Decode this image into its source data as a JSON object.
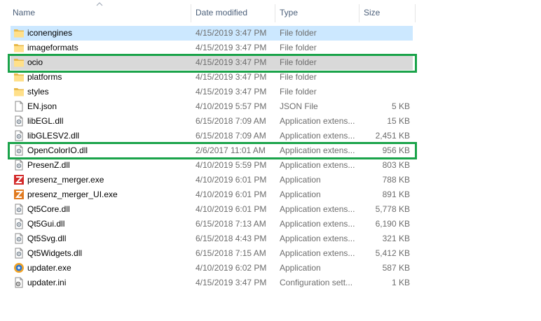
{
  "columns": {
    "name": "Name",
    "date_modified": "Date modified",
    "type": "Type",
    "size": "Size"
  },
  "sort": {
    "column": "name",
    "direction": "ascending",
    "icon": "sort-up-chevron"
  },
  "accent_color": "#1aa34a",
  "files": [
    {
      "name": "iconengines",
      "date": "4/15/2019 3:47 PM",
      "type": "File folder",
      "size": "",
      "icon": "folder-icon",
      "state": "selected"
    },
    {
      "name": "imageformats",
      "date": "4/15/2019 3:47 PM",
      "type": "File folder",
      "size": "",
      "icon": "folder-icon",
      "state": ""
    },
    {
      "name": "ocio",
      "date": "4/15/2019 3:47 PM",
      "type": "File folder",
      "size": "",
      "icon": "folder-icon",
      "state": "hover"
    },
    {
      "name": "platforms",
      "date": "4/15/2019 3:47 PM",
      "type": "File folder",
      "size": "",
      "icon": "folder-icon",
      "state": ""
    },
    {
      "name": "styles",
      "date": "4/15/2019 3:47 PM",
      "type": "File folder",
      "size": "",
      "icon": "folder-icon",
      "state": ""
    },
    {
      "name": "EN.json",
      "date": "4/10/2019 5:57 PM",
      "type": "JSON File",
      "size": "5 KB",
      "icon": "document-icon",
      "state": ""
    },
    {
      "name": "libEGL.dll",
      "date": "6/15/2018 7:09 AM",
      "type": "Application extens...",
      "size": "15 KB",
      "icon": "dll-gear-icon",
      "state": ""
    },
    {
      "name": "libGLESV2.dll",
      "date": "6/15/2018 7:09 AM",
      "type": "Application extens...",
      "size": "2,451 KB",
      "icon": "dll-gear-icon",
      "state": ""
    },
    {
      "name": "OpenColorIO.dll",
      "date": "2/6/2017 11:01 AM",
      "type": "Application extens...",
      "size": "956 KB",
      "icon": "dll-gear-icon",
      "state": ""
    },
    {
      "name": "PresenZ.dll",
      "date": "4/10/2019 5:59 PM",
      "type": "Application extens...",
      "size": "803 KB",
      "icon": "dll-gear-icon",
      "state": ""
    },
    {
      "name": "presenz_merger.exe",
      "date": "4/10/2019 6:01 PM",
      "type": "Application",
      "size": "788 KB",
      "icon": "z-app-red-icon",
      "state": ""
    },
    {
      "name": "presenz_merger_UI.exe",
      "date": "4/10/2019 6:01 PM",
      "type": "Application",
      "size": "891 KB",
      "icon": "z-app-orange-icon",
      "state": ""
    },
    {
      "name": "Qt5Core.dll",
      "date": "4/10/2019 6:01 PM",
      "type": "Application extens...",
      "size": "5,778 KB",
      "icon": "dll-gear-icon",
      "state": ""
    },
    {
      "name": "Qt5Gui.dll",
      "date": "6/15/2018 7:13 AM",
      "type": "Application extens...",
      "size": "6,190 KB",
      "icon": "dll-gear-icon",
      "state": ""
    },
    {
      "name": "Qt5Svg.dll",
      "date": "6/15/2018 4:43 PM",
      "type": "Application extens...",
      "size": "321 KB",
      "icon": "dll-gear-icon",
      "state": ""
    },
    {
      "name": "Qt5Widgets.dll",
      "date": "6/15/2018 7:15 AM",
      "type": "Application extens...",
      "size": "5,412 KB",
      "icon": "dll-gear-icon",
      "state": ""
    },
    {
      "name": "updater.exe",
      "date": "4/10/2019 6:02 PM",
      "type": "Application",
      "size": "587 KB",
      "icon": "updater-app-icon",
      "state": ""
    },
    {
      "name": "updater.ini",
      "date": "4/15/2019 3:47 PM",
      "type": "Configuration sett...",
      "size": "1 KB",
      "icon": "config-gear-icon",
      "state": ""
    }
  ]
}
